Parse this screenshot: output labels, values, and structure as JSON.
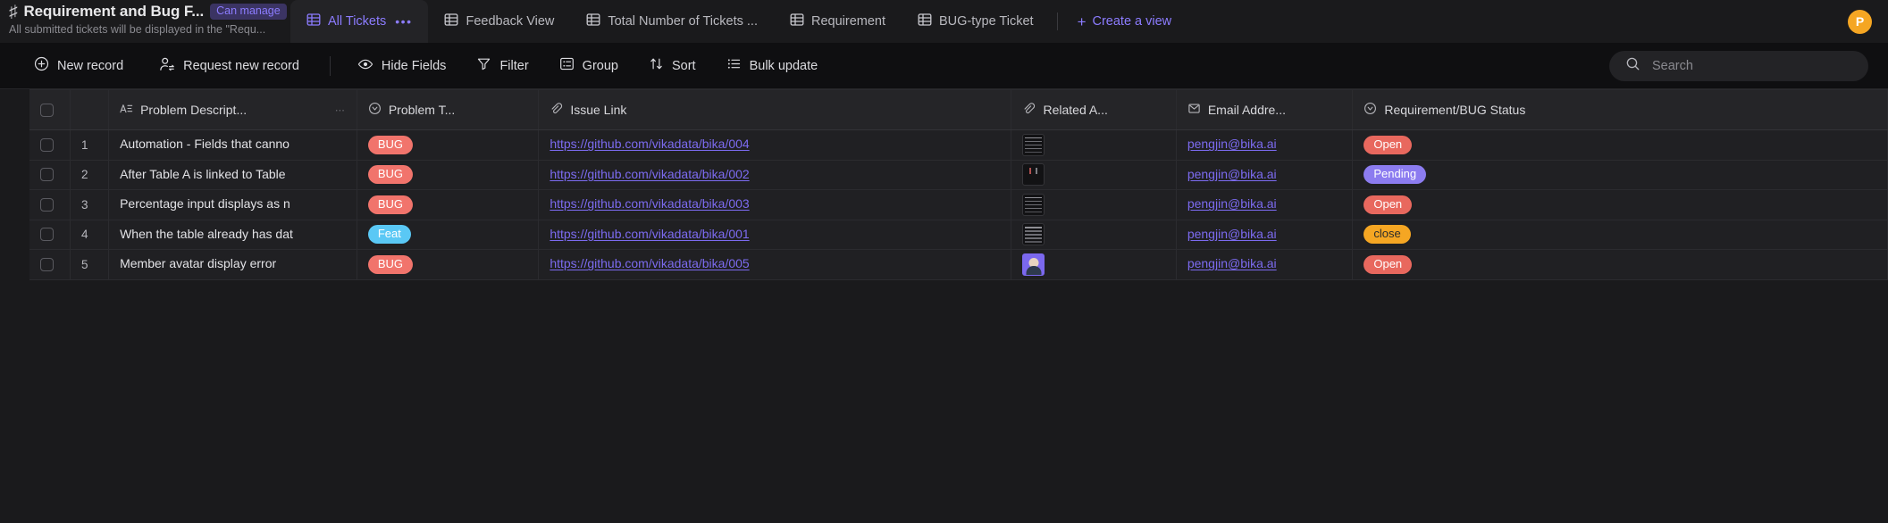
{
  "workspace": {
    "hash_icon": "hash-icon",
    "title": "Requirement and Bug F...",
    "permission_badge": "Can manage",
    "subtitle": "All submitted tickets will be displayed in the \"Requ..."
  },
  "tabs": [
    {
      "label": "All Tickets",
      "icon": "grid-icon",
      "active": true,
      "dots": "•••"
    },
    {
      "label": "Feedback View",
      "icon": "grid-icon",
      "active": false
    },
    {
      "label": "Total Number of Tickets ...",
      "icon": "grid-icon",
      "active": false
    },
    {
      "label": "Requirement",
      "icon": "grid-icon",
      "active": false
    },
    {
      "label": "BUG-type Ticket",
      "icon": "grid-icon",
      "active": false
    }
  ],
  "create_view": {
    "label": "Create a view",
    "icon": "plus-icon"
  },
  "user": {
    "avatar_initial": "P",
    "avatar_color": "#f5a623"
  },
  "toolbar": {
    "new_record": "New record",
    "request_new_record": "Request new record",
    "hide_fields": "Hide Fields",
    "filter": "Filter",
    "group": "Group",
    "sort": "Sort",
    "bulk_update": "Bulk update"
  },
  "search": {
    "placeholder": "Search",
    "value": "",
    "icon": "search-icon"
  },
  "grid": {
    "columns": [
      {
        "key": "desc",
        "label": "Problem Descript...",
        "icon": "text-field-icon"
      },
      {
        "key": "ptype",
        "label": "Problem T...",
        "icon": "single-select-icon"
      },
      {
        "key": "link",
        "label": "Issue Link",
        "icon": "link-icon"
      },
      {
        "key": "rel",
        "label": "Related A...",
        "icon": "attachment-icon"
      },
      {
        "key": "email",
        "label": "Email Addre...",
        "icon": "email-icon"
      },
      {
        "key": "status",
        "label": "Requirement/BUG Status",
        "icon": "single-select-icon"
      }
    ],
    "rows": [
      {
        "num": "1",
        "desc": "Automation - Fields that canno",
        "ptype": "BUG",
        "ptype_color": "#f1746c",
        "link": "https://github.com/vikadata/bika/004",
        "attachment": "doc",
        "email": "pengjin@bika.ai",
        "status": "Open",
        "status_color": "#e8685e",
        "status_text_dark": false
      },
      {
        "num": "2",
        "desc": "After Table A is linked to Table",
        "ptype": "BUG",
        "ptype_color": "#f1746c",
        "link": "https://github.com/vikadata/bika/002",
        "attachment": "sparse",
        "email": "pengjin@bika.ai",
        "status": "Pending",
        "status_color": "#8c7cf0",
        "status_text_dark": false
      },
      {
        "num": "3",
        "desc": "Percentage input displays as n",
        "ptype": "BUG",
        "ptype_color": "#f1746c",
        "link": "https://github.com/vikadata/bika/003",
        "attachment": "doc",
        "email": "pengjin@bika.ai",
        "status": "Open",
        "status_color": "#e8685e",
        "status_text_dark": false
      },
      {
        "num": "4",
        "desc": "When the table already has dat",
        "ptype": "Feat",
        "ptype_color": "#5ac8f5",
        "link": "https://github.com/vikadata/bika/001",
        "attachment": "doc",
        "email": "pengjin@bika.ai",
        "status": "close",
        "status_color": "#f5a623",
        "status_text_dark": true
      },
      {
        "num": "5",
        "desc": "Member avatar display error",
        "ptype": "BUG",
        "ptype_color": "#f1746c",
        "link": "https://github.com/vikadata/bika/005",
        "attachment": "person",
        "email": "pengjin@bika.ai",
        "status": "Open",
        "status_color": "#e8685e",
        "status_text_dark": false
      }
    ]
  }
}
